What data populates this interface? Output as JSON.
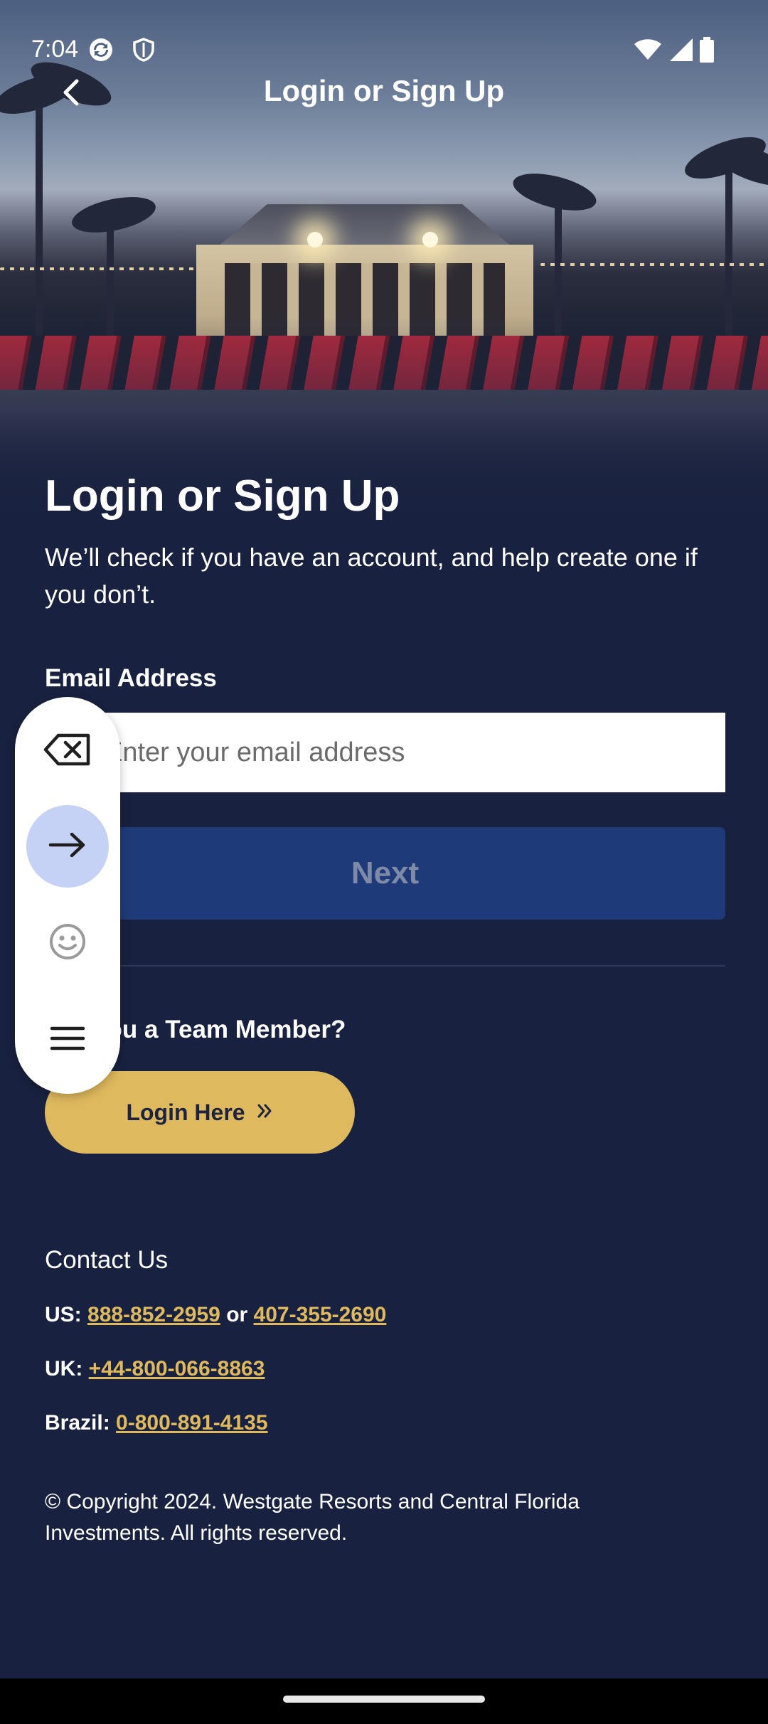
{
  "status_bar": {
    "time": "7:04",
    "icons": [
      "sync-icon",
      "shield-icon",
      "wifi-icon",
      "signal-icon",
      "battery-icon"
    ]
  },
  "top_nav": {
    "title": "Login or Sign Up",
    "back_icon": "chevron-left-icon"
  },
  "main": {
    "title": "Login or Sign Up",
    "subtitle": "We’ll check if you have an account, and help create one if you don’t.",
    "email_label": "Email Address",
    "email_placeholder": "Enter your email address",
    "email_value": "",
    "next_label": "Next",
    "team_heading": "Are you a Team Member?",
    "login_here_label": "Login Here",
    "login_here_icon": "double-chevron-right-icon"
  },
  "contact": {
    "heading": "Contact Us",
    "us_label": "US:",
    "us_phone_1": "888-852-2959",
    "us_or": "or",
    "us_phone_2": "407-355-2690",
    "uk_label": "UK:",
    "uk_phone": "+44-800-066-8863",
    "brazil_label": "Brazil:",
    "brazil_phone": "0-800-891-4135"
  },
  "copyright": "© Copyright 2024. Westgate Resorts and Central Florida Investments. All rights reserved.",
  "keyboard_toolbar": {
    "items": [
      "backspace-icon",
      "arrow-right-icon",
      "emoji-icon",
      "menu-icon"
    ],
    "active": "arrow-right-icon"
  },
  "colors": {
    "background": "#18213f",
    "accent_gold": "#dfb95e",
    "button_blue": "#1f3a78",
    "button_text_disabled": "#7e8aa7",
    "toolbar_active": "#c6d2f5"
  }
}
